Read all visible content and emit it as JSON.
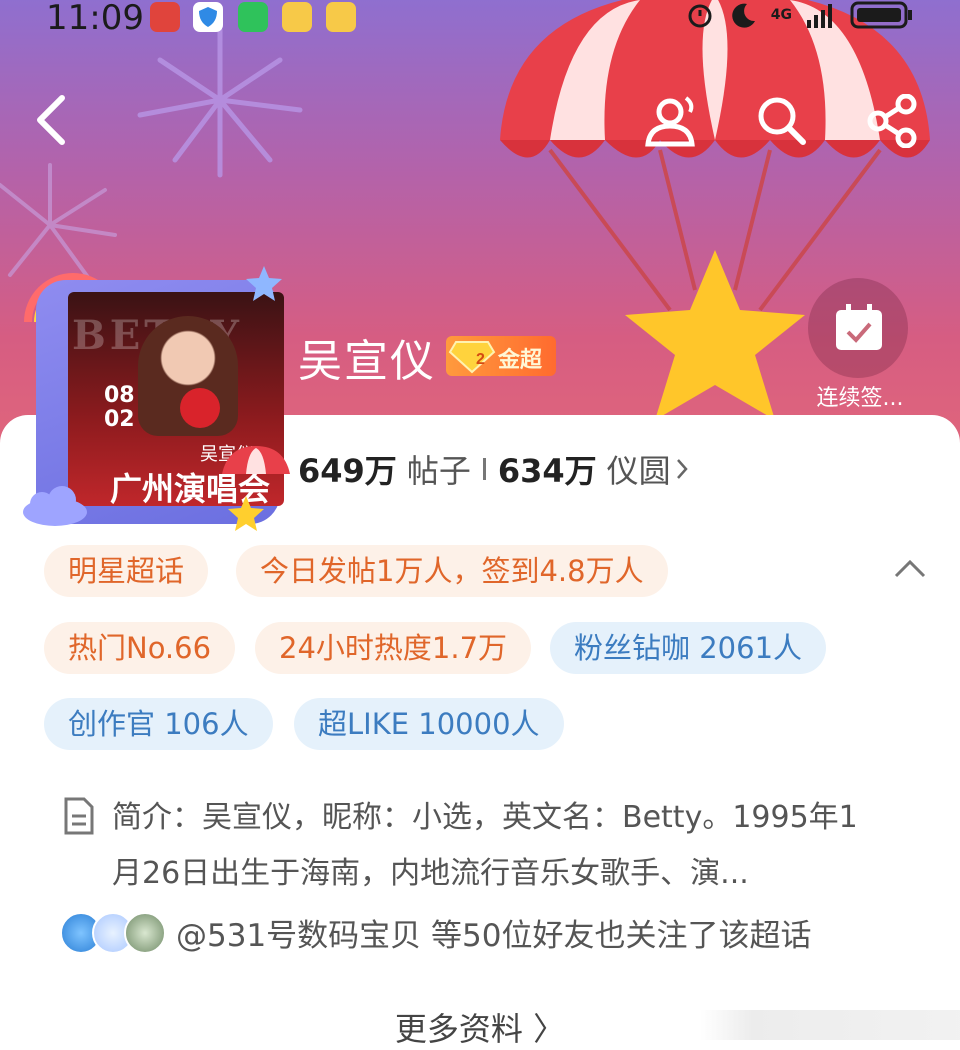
{
  "status_bar": {
    "time": "11:09",
    "network": "4G"
  },
  "topic": {
    "name": "吴宣仪",
    "badge": "金超",
    "poster_name": "吴宣仪",
    "poster_title": "广州演唱会",
    "poster_date": "08 02",
    "poster_bg_text": "BETTY"
  },
  "checkin": {
    "label": "连续签..."
  },
  "stats": [
    {
      "value": "649万",
      "label": "帖子"
    },
    {
      "value": "634万",
      "label": "仪圆"
    }
  ],
  "tags": [
    {
      "text": "明星超话",
      "tone": "orange"
    },
    {
      "text": "今日发帖1万人，签到4.8万人",
      "tone": "orange"
    },
    {
      "text": "热门No.66",
      "tone": "orange"
    },
    {
      "text": "24小时热度1.7万",
      "tone": "orange"
    },
    {
      "text": "粉丝钻咖 2061人",
      "tone": "blue"
    },
    {
      "text": "创作官 106人",
      "tone": "blue"
    },
    {
      "text": "超LIKE 10000人",
      "tone": "blue"
    }
  ],
  "intro": {
    "text": "简介：吴宣仪，昵称：小选，英文名：Betty。1995年1月26日出生于海南，内地流行音乐女歌手、演..."
  },
  "friends": {
    "text": "@531号数码宝贝 等50位好友也关注了该超话"
  },
  "more": {
    "label": "更多资料 〉"
  },
  "colors": {
    "header_top": "#8f6fcf",
    "header_bottom": "#e2677a",
    "tag_orange_bg": "#fdf1e8",
    "tag_orange_text": "#e0662a",
    "tag_blue_bg": "#e5f1fb",
    "tag_blue_text": "#3c7cc0",
    "badge": "#ff7a33"
  },
  "icons": [
    "back-arrow-icon",
    "user-follow-icon",
    "search-icon",
    "share-icon",
    "calendar-check-icon",
    "document-icon",
    "chevron-up-icon",
    "chevron-right-icon",
    "diamond-icon"
  ]
}
